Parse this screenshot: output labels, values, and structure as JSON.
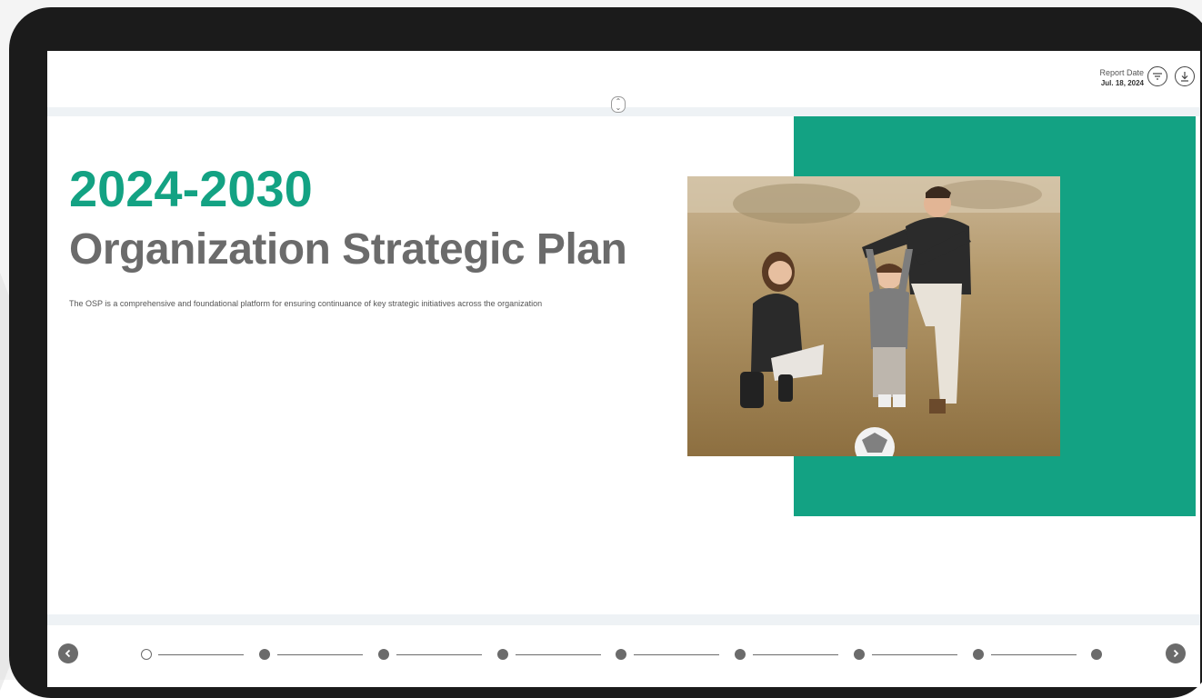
{
  "header": {
    "report_date_label": "Report Date",
    "report_date_value": "Jul. 18, 2024",
    "filter_icon": "filter-icon",
    "download_icon": "download-icon"
  },
  "hero": {
    "years": "2024-2030",
    "title": "Organization Strategic Plan",
    "description": "The OSP is a comprehensive and foundational platform for ensuring continuance of key strategic initiatives across the organization"
  },
  "colors": {
    "accent": "#13a283",
    "title_gray": "#6b6b6b"
  },
  "timeline": {
    "steps": [
      {
        "state": "current"
      },
      {
        "state": "default"
      },
      {
        "state": "default"
      },
      {
        "state": "default"
      },
      {
        "state": "default"
      },
      {
        "state": "default"
      },
      {
        "state": "default"
      },
      {
        "state": "default"
      },
      {
        "state": "default"
      }
    ],
    "prev_icon": "chevron-left-icon",
    "next_icon": "chevron-right-icon"
  }
}
